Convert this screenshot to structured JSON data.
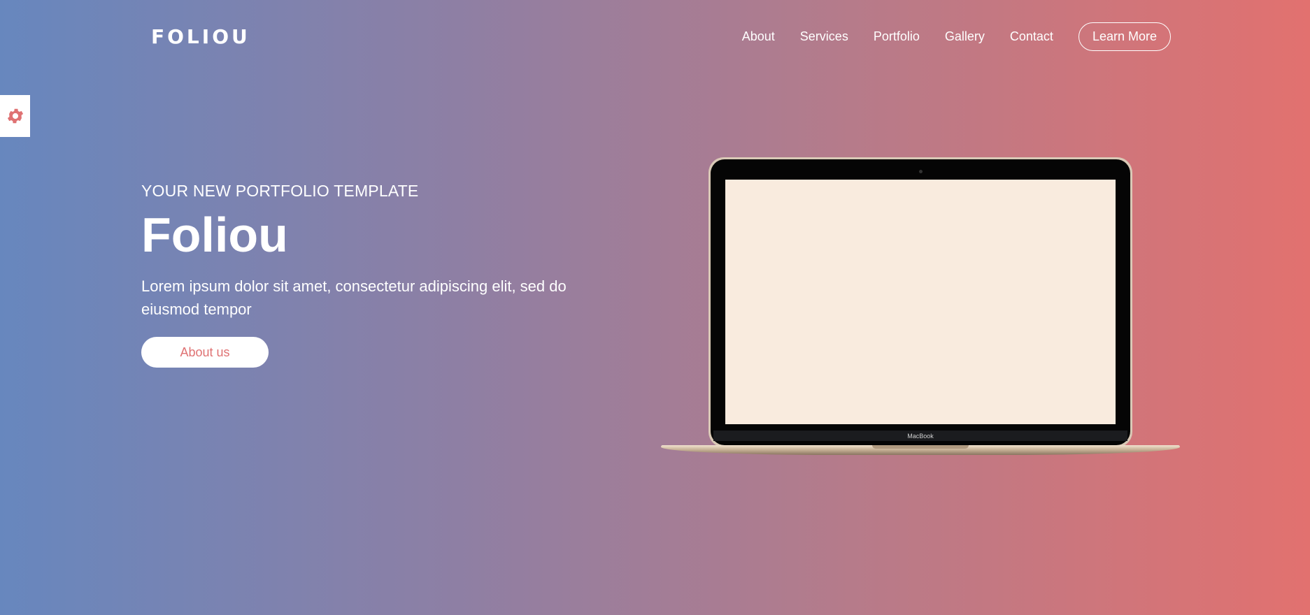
{
  "brand": {
    "logo": "FOLIOU"
  },
  "nav": {
    "links": [
      "About",
      "Services",
      "Portfolio",
      "Gallery",
      "Contact"
    ],
    "cta": "Learn More"
  },
  "hero": {
    "eyebrow": "YOUR NEW PORTFOLIO TEMPLATE",
    "title": "Foliou",
    "text": "Lorem ipsum dolor sit amet, consectetur adipiscing elit, sed do eiusmod tempor",
    "button": "About us"
  },
  "laptop": {
    "label": "MacBook"
  },
  "icons": {
    "settings": "gear-icon"
  },
  "colors": {
    "gradient_start": "#6787be",
    "gradient_end": "#e2716f",
    "accent": "#df7273",
    "screen": "#f9ebde"
  }
}
